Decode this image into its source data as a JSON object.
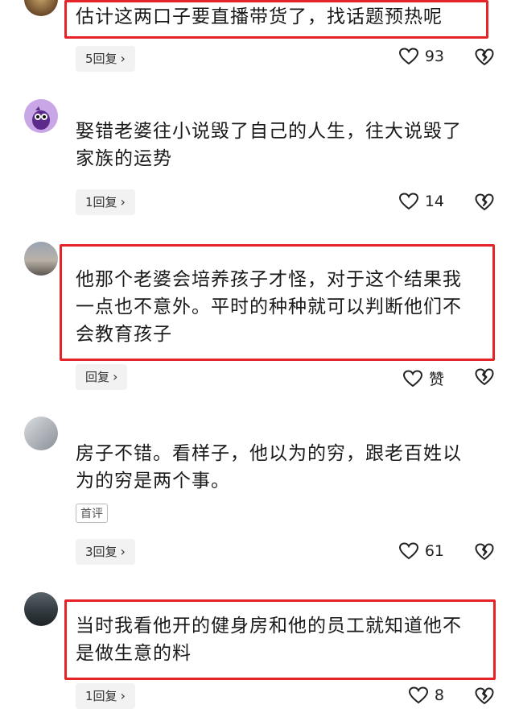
{
  "comments": [
    {
      "text_lines": [
        "估计这两口子要直播带货了，找话题预热呢"
      ],
      "reply_label": "5回复",
      "likes": "93"
    },
    {
      "text_lines": [
        "娶错老婆往小说毁了自己的人生，往大说毁了",
        "家族的运势"
      ],
      "reply_label": "1回复",
      "likes": "14"
    },
    {
      "text_lines": [
        "他那个老婆会培养孩子才怪，对于这个结果我",
        "一点也不意外。平时的种种就可以判断他们不",
        "会教育孩子"
      ],
      "reply_label": "回复",
      "likes": "赞"
    },
    {
      "text_lines": [
        "房子不错。看样子，他以为的穷，跟老百姓以",
        "为的穷是两个事。"
      ],
      "badge": "首评",
      "reply_label": "3回复",
      "likes": "61"
    },
    {
      "text_lines": [
        "当时我看他开的健身房和他的员工就知道他不",
        "是做生意的料"
      ],
      "reply_label": "1回复",
      "likes": "8"
    }
  ],
  "icons": {
    "like": "heart-outline-icon",
    "dislike": "broken-heart-icon",
    "chevron": "chevron-right-icon"
  },
  "colors": {
    "highlight": "#e52428",
    "pill_bg": "#f2f2f2"
  }
}
